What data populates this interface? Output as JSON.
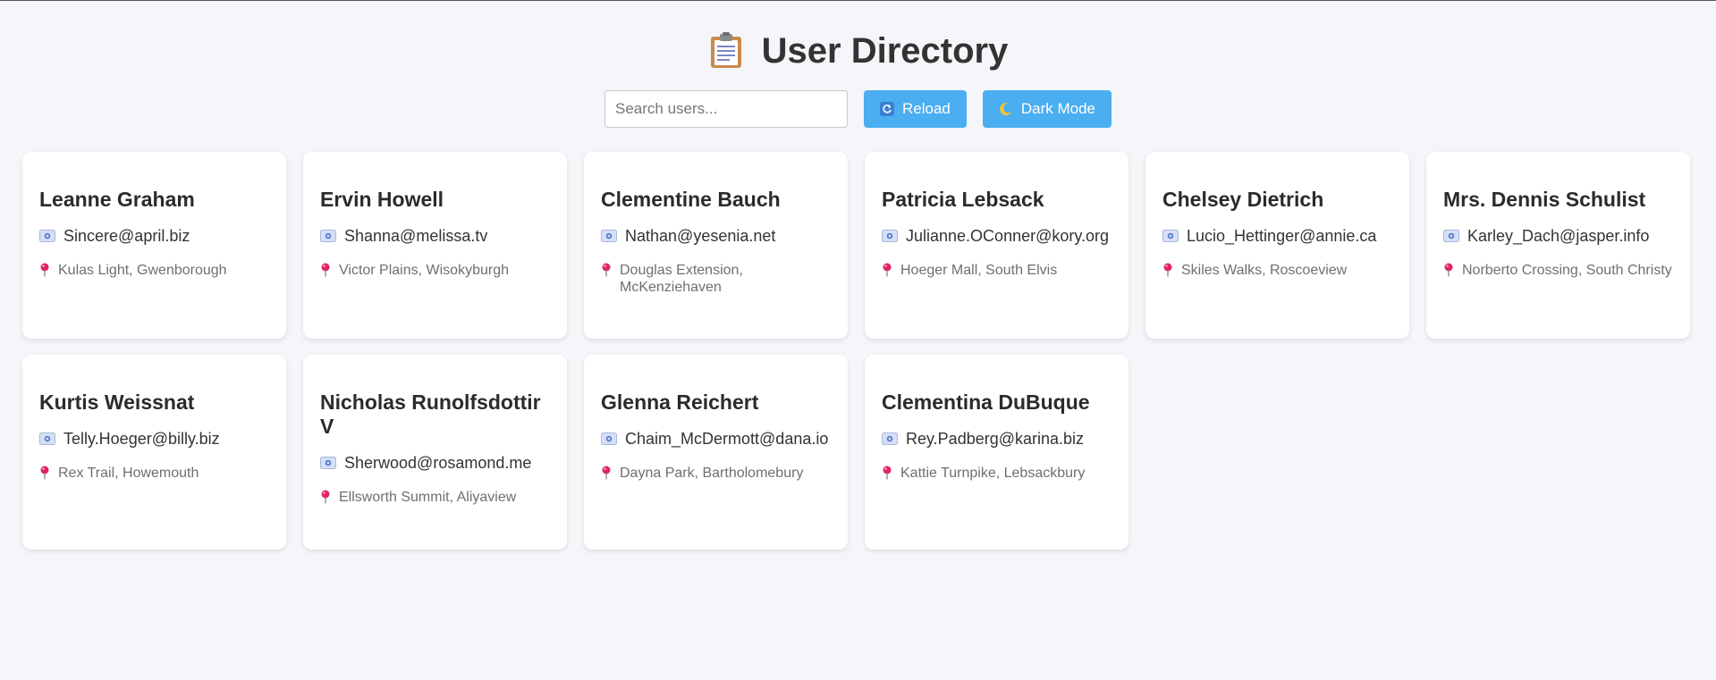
{
  "header": {
    "icon": "clipboard-icon",
    "title": "User Directory"
  },
  "controls": {
    "search_placeholder": "Search users...",
    "reload_label": "Reload",
    "reload_icon": "refresh-icon",
    "dark_mode_label": "Dark Mode",
    "dark_mode_icon": "moon-icon"
  },
  "colors": {
    "background": "#f4f6f9",
    "button": "#4aaef0",
    "card": "#ffffff",
    "pin": "#e0245e"
  },
  "users": [
    {
      "name": "Leanne Graham",
      "email": "Sincere@april.biz",
      "address": "Kulas Light, Gwenborough"
    },
    {
      "name": "Ervin Howell",
      "email": "Shanna@melissa.tv",
      "address": "Victor Plains, Wisokyburgh"
    },
    {
      "name": "Clementine Bauch",
      "email": "Nathan@yesenia.net",
      "address": "Douglas Extension, McKenziehaven"
    },
    {
      "name": "Patricia Lebsack",
      "email": "Julianne.OConner@kory.org",
      "address": "Hoeger Mall, South Elvis"
    },
    {
      "name": "Chelsey Dietrich",
      "email": "Lucio_Hettinger@annie.ca",
      "address": "Skiles Walks, Roscoeview"
    },
    {
      "name": "Mrs. Dennis Schulist",
      "email": "Karley_Dach@jasper.info",
      "address": "Norberto Crossing, South Christy"
    },
    {
      "name": "Kurtis Weissnat",
      "email": "Telly.Hoeger@billy.biz",
      "address": "Rex Trail, Howemouth"
    },
    {
      "name": "Nicholas Runolfsdottir V",
      "email": "Sherwood@rosamond.me",
      "address": "Ellsworth Summit, Aliyaview"
    },
    {
      "name": "Glenna Reichert",
      "email": "Chaim_McDermott@dana.io",
      "address": "Dayna Park, Bartholomebury"
    },
    {
      "name": "Clementina DuBuque",
      "email": "Rey.Padberg@karina.biz",
      "address": "Kattie Turnpike, Lebsackbury"
    }
  ]
}
